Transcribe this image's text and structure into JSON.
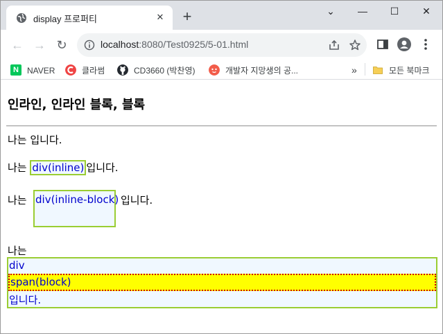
{
  "browser": {
    "tab_title": "display 프로퍼티",
    "tab_close_glyph": "✕",
    "new_tab_glyph": "+",
    "url_host": "localhost",
    "url_path": ":8080/Test0925/5-01.html",
    "window_controls": [
      "⌄",
      "—",
      "☐",
      "✕"
    ],
    "nav": {
      "back": "←",
      "forward": "→",
      "reload": "↻"
    }
  },
  "bookmarks": {
    "items": [
      {
        "label": "NAVER",
        "icon": "naver-icon",
        "color": "#03c75a"
      },
      {
        "label": "클라썸",
        "icon": "classum-icon",
        "color": "#ef4444"
      },
      {
        "label": "CD3660 (박찬영)",
        "icon": "github-icon",
        "color": "#24292f"
      },
      {
        "label": "개발자 지망생의 공...",
        "icon": "blog-icon",
        "color": "#f25c4a"
      }
    ],
    "overflow": "»",
    "all_bookmarks": "모든 북마크",
    "folder_color": "#f6cf57"
  },
  "page": {
    "heading": "인라인, 인라인 블록, 블록",
    "line1": "나는 입니다.",
    "line2_prefix": "나는 ",
    "line2_div": "div(inline)",
    "line2_suffix": "입니다.",
    "line3_prefix": "나는 ",
    "line3_div": "div(inline-block)",
    "line3_suffix": "입니다.",
    "line4": "나는",
    "block_div": "div",
    "block_span": "span(block)",
    "block_end": "입니다."
  },
  "colors": {
    "div_border": "#9acd32",
    "div_background": "#f0f8ff",
    "div_text": "#0000cd",
    "span_background": "#ffff00",
    "span_border": "#cc0000"
  }
}
